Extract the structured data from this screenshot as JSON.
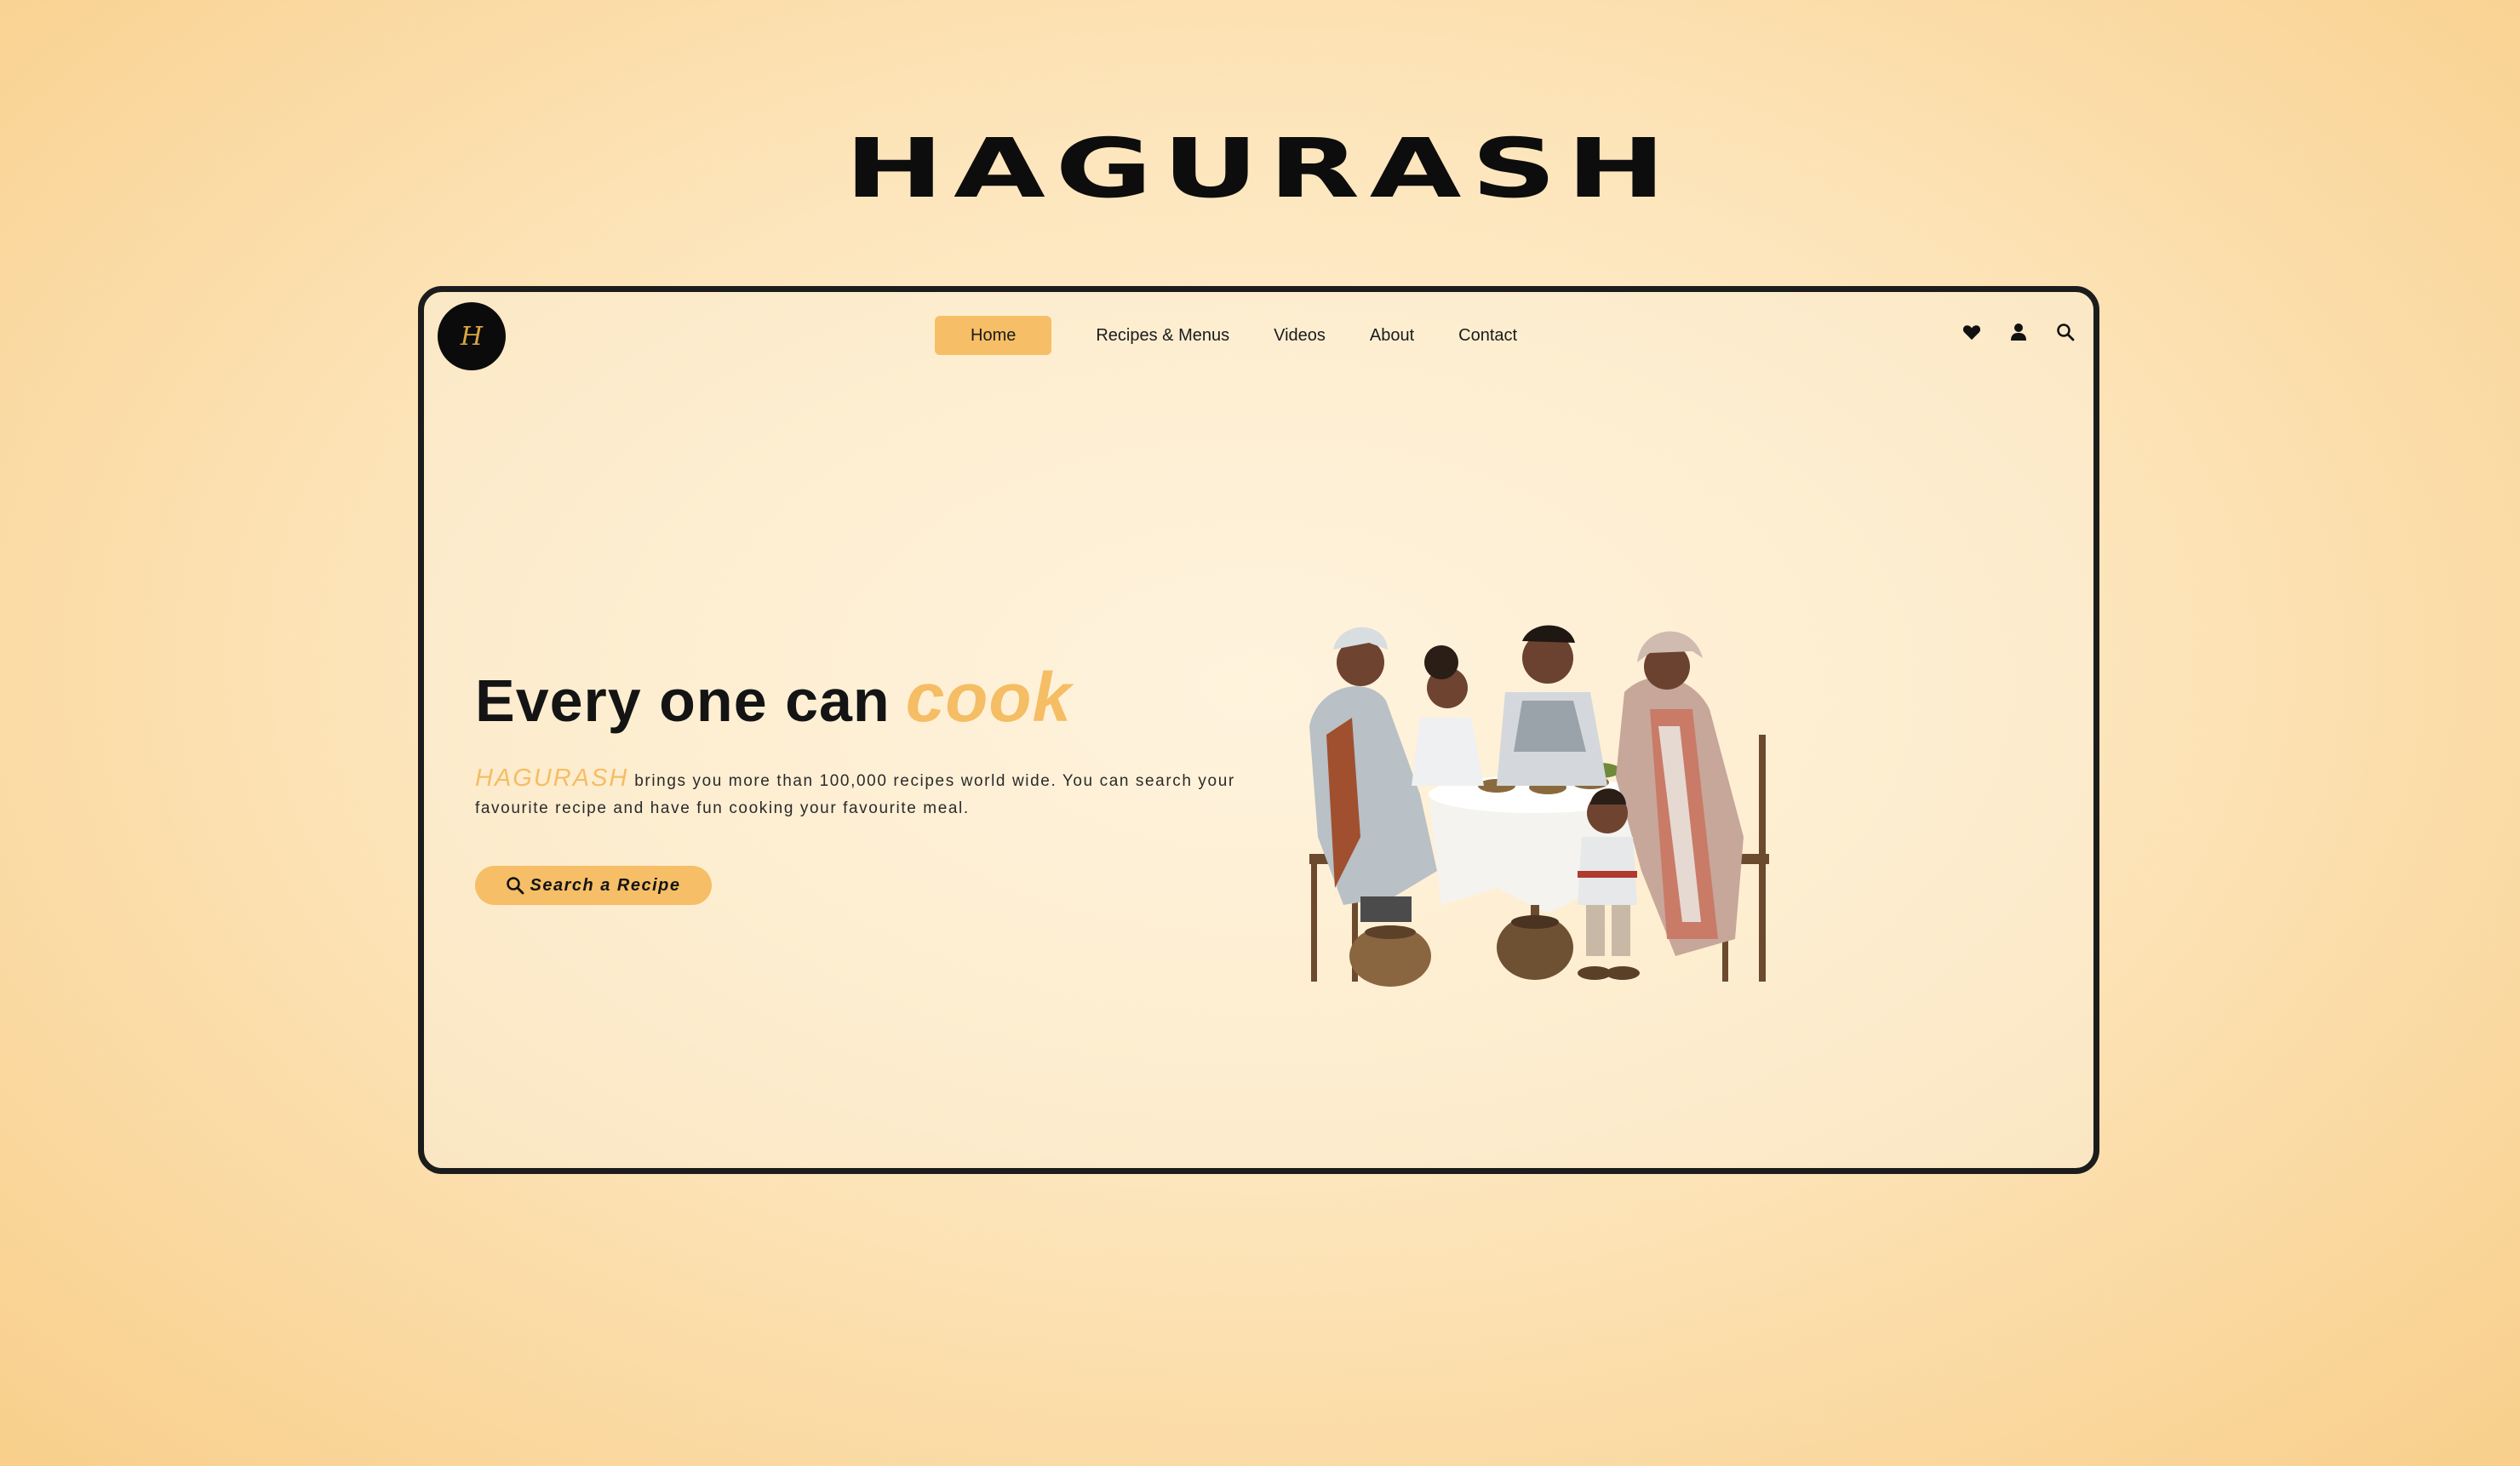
{
  "page": {
    "brand_title": "HAGURASH"
  },
  "header": {
    "logo_letter": "H",
    "nav": [
      {
        "label": "Home",
        "active": true
      },
      {
        "label": "Recipes & Menus",
        "active": false
      },
      {
        "label": "Videos",
        "active": false
      },
      {
        "label": "About",
        "active": false
      },
      {
        "label": "Contact",
        "active": false
      }
    ],
    "icons": [
      "heart-icon",
      "user-icon",
      "search-icon"
    ]
  },
  "hero": {
    "headline": "Every one can",
    "headline_accent": "cook",
    "brand_name": "HAGURASH",
    "description": " brings you more than 100,000 recipes world wide. You can search your favourite recipe and have fun cooking your favourite meal.",
    "cta_label": "Search a Recipe"
  },
  "colors": {
    "accent": "#f6be66",
    "text": "#141414",
    "frame_border": "#1c1c1c"
  }
}
